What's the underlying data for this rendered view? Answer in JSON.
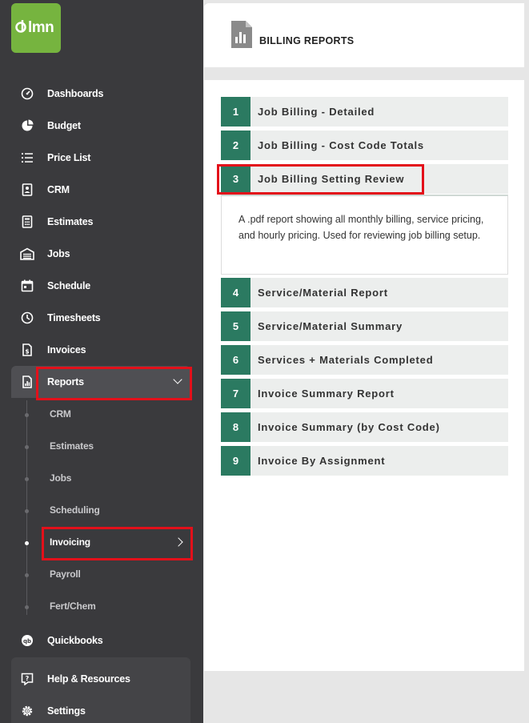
{
  "brand": {
    "logo_text": "lmn",
    "accent": "#76b43f"
  },
  "sidebar": {
    "items": [
      {
        "id": "dashboards",
        "label": "Dashboards",
        "icon": "dashboard-gauge-icon"
      },
      {
        "id": "budget",
        "label": "Budget",
        "icon": "pie-chart-icon"
      },
      {
        "id": "price-list",
        "label": "Price List",
        "icon": "list-icon"
      },
      {
        "id": "crm",
        "label": "CRM",
        "icon": "contact-card-icon"
      },
      {
        "id": "estimates",
        "label": "Estimates",
        "icon": "calculator-icon"
      },
      {
        "id": "jobs",
        "label": "Jobs",
        "icon": "garage-icon"
      },
      {
        "id": "schedule",
        "label": "Schedule",
        "icon": "calendar-icon"
      },
      {
        "id": "timesheets",
        "label": "Timesheets",
        "icon": "clock-icon"
      },
      {
        "id": "invoices",
        "label": "Invoices",
        "icon": "invoice-icon"
      },
      {
        "id": "reports",
        "label": "Reports",
        "icon": "report-icon"
      }
    ],
    "reports_sub": [
      {
        "id": "crm",
        "label": "CRM"
      },
      {
        "id": "estimates",
        "label": "Estimates"
      },
      {
        "id": "jobs",
        "label": "Jobs"
      },
      {
        "id": "scheduling",
        "label": "Scheduling"
      },
      {
        "id": "invoicing",
        "label": "Invoicing"
      },
      {
        "id": "payroll",
        "label": "Payroll"
      },
      {
        "id": "fert-chem",
        "label": "Fert/Chem"
      }
    ],
    "quickbooks": {
      "label": "Quickbooks",
      "icon": "quickbooks-icon"
    },
    "help": {
      "label": "Help & Resources",
      "icon": "help-icon"
    },
    "settings": {
      "label": "Settings",
      "icon": "gear-icon"
    }
  },
  "page": {
    "title": "BILLING REPORTS",
    "reports": [
      {
        "num": "1",
        "title": "Job Billing - Detailed"
      },
      {
        "num": "2",
        "title": "Job Billing - Cost Code Totals"
      },
      {
        "num": "3",
        "title": "Job Billing Setting Review",
        "description": "A .pdf report showing all monthly billing, service pricing, and hourly pricing. Used for reviewing job billing setup."
      },
      {
        "num": "4",
        "title": "Service/Material Report"
      },
      {
        "num": "5",
        "title": "Service/Material Summary"
      },
      {
        "num": "6",
        "title": "Services + Materials Completed"
      },
      {
        "num": "7",
        "title": "Invoice Summary Report"
      },
      {
        "num": "8",
        "title": "Invoice Summary (by Cost Code)"
      },
      {
        "num": "9",
        "title": "Invoice By Assignment"
      }
    ]
  },
  "colors": {
    "sidebar_bg": "#3a3a3d",
    "number_badge": "#2b7a61",
    "highlight": "#e3101a"
  }
}
